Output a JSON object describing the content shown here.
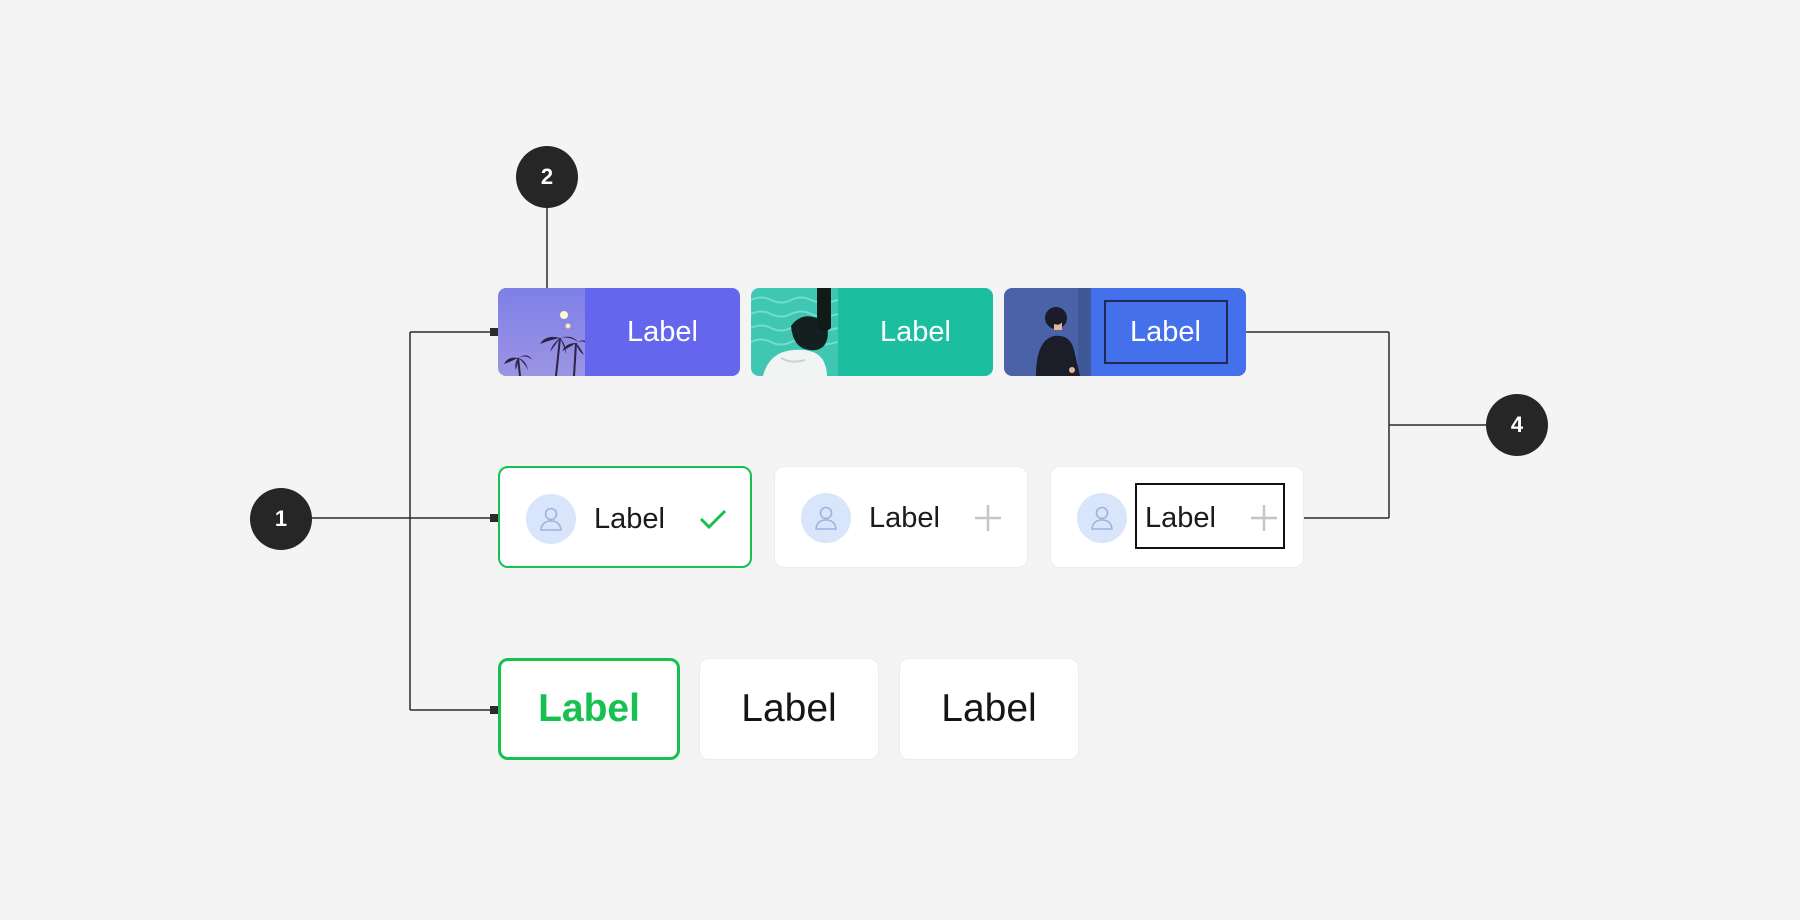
{
  "markers": {
    "m1": "1",
    "m2": "2",
    "m4": "4"
  },
  "image_chips": [
    {
      "label": "Label",
      "color": "#6466ee",
      "thumb": "palm-trees-dusk-image"
    },
    {
      "label": "Label",
      "color": "#1bbf9f",
      "thumb": "person-by-water-image"
    },
    {
      "label": "Label",
      "color": "#4470ec",
      "thumb": "man-portrait-image",
      "focused": true
    }
  ],
  "avatar_chips": [
    {
      "label": "Label",
      "trailing_icon": "check-icon",
      "selected": true
    },
    {
      "label": "Label",
      "trailing_icon": "plus-icon",
      "selected": false
    },
    {
      "label": "Label",
      "trailing_icon": "plus-icon",
      "selected": false,
      "focused": true
    }
  ],
  "text_chips": [
    {
      "label": "Label",
      "selected": true
    },
    {
      "label": "Label",
      "selected": false
    },
    {
      "label": "Label",
      "selected": false
    }
  ],
  "colors": {
    "background": "#f4f4f4",
    "marker": "#262626",
    "selected_green": "#16c150",
    "avatar_bg": "#d9e5fb"
  }
}
